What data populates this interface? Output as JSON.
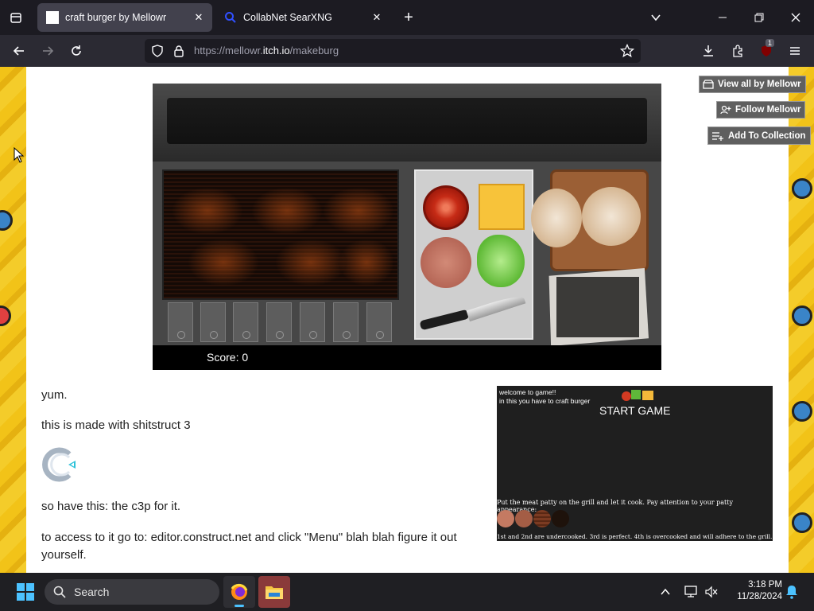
{
  "browser": {
    "tabs": [
      {
        "title": "craft burger by Mellowr",
        "active": true
      },
      {
        "title": "CollabNet SearXNG",
        "active": false
      }
    ],
    "url": {
      "prefix": "https://mellowr.",
      "domain": "itch.io",
      "path": "/makeburg"
    },
    "extensions_badge": "1"
  },
  "game": {
    "score_label": "Score: 0"
  },
  "sidebar": {
    "view_all": "View all by Mellowr",
    "follow": "Follow Mellowr",
    "add_collection": "Add To Collection"
  },
  "description": {
    "p1": "yum.",
    "p2": "this is made with shitstruct 3",
    "p3": "so have this: the c3p for it.",
    "p4": "to access to it go to: editor.construct.net and click \"Menu\" blah blah figure it out yourself."
  },
  "screenshot": {
    "line1": "welcome to game!!",
    "line2": "in this you have to craft burger",
    "start": "START GAME",
    "instruction": "Put the meat patty on the grill and let it cook. Pay attention to your patty appearance:",
    "note": "1st and 2nd are undercooked. 3rd is perfect. 4th is overcooked and will adhere to the grill.",
    "patty_colors": [
      "#c47a62",
      "#a45d45",
      "#7b3b22",
      "#1e120b"
    ]
  },
  "taskbar": {
    "search_label": "Search",
    "time": "3:18 PM",
    "date": "11/28/2024"
  },
  "colors": {
    "accent_blue": "#0a84ff",
    "page_background": "#f2c318"
  }
}
